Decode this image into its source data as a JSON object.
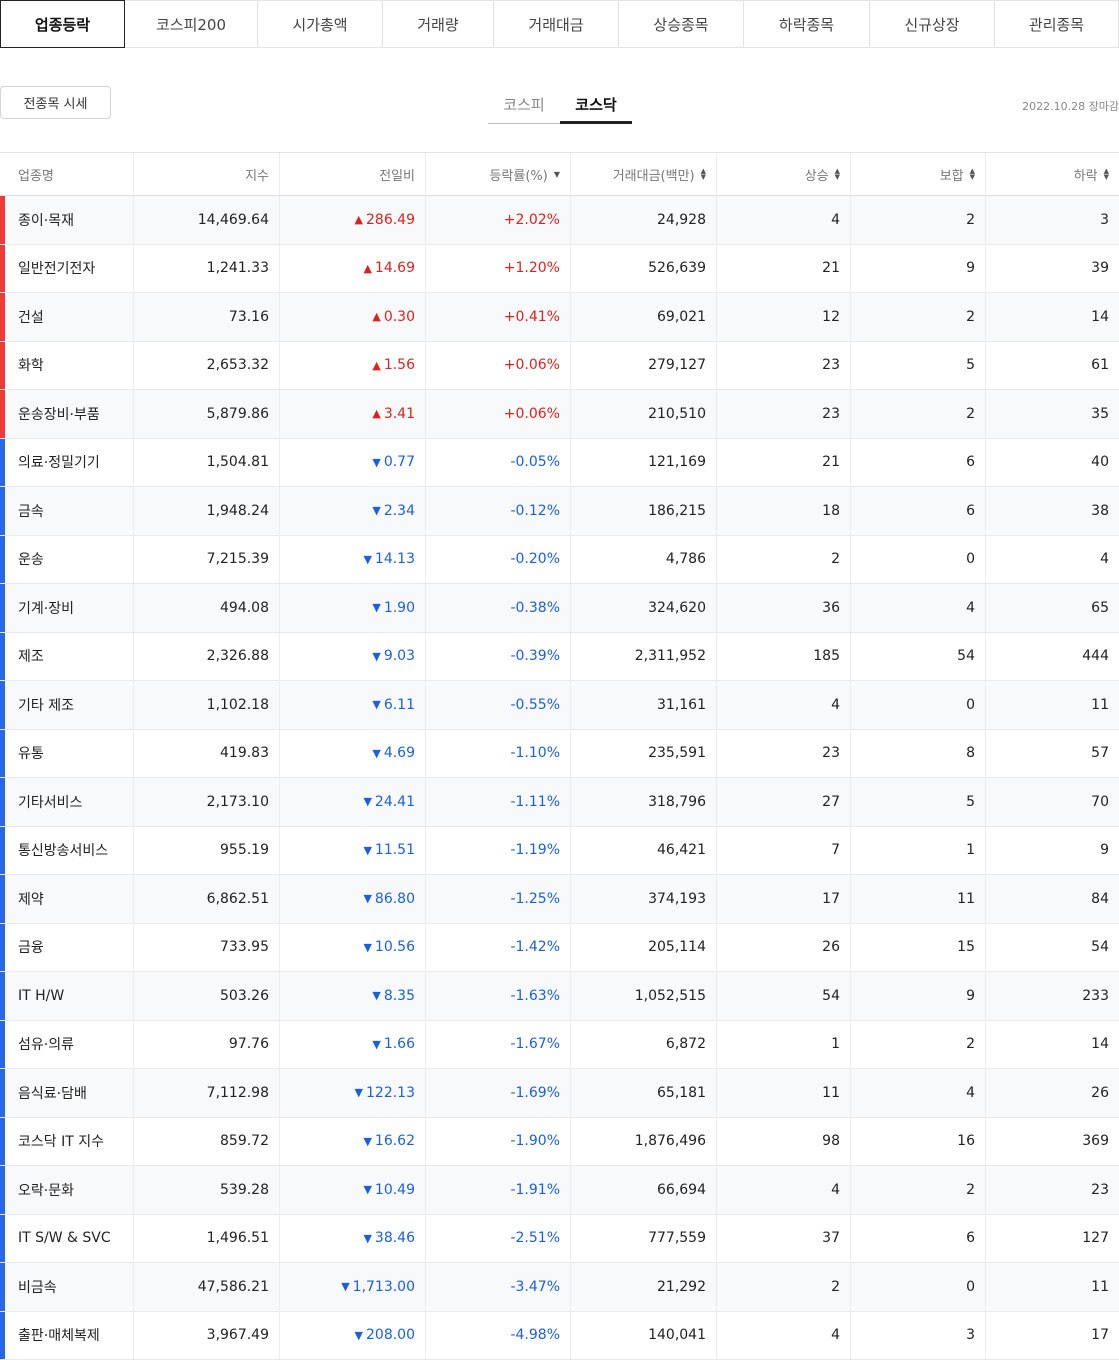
{
  "top_tabs": [
    "업종등락",
    "코스피200",
    "시가총액",
    "거래량",
    "거래대금",
    "상승종목",
    "하락종목",
    "신규상장",
    "관리종목"
  ],
  "all_stocks_button": "전종목 시세",
  "market_tabs": [
    "코스피",
    "코스닥"
  ],
  "active_market": "코스닥",
  "date_label": "2022.10.28 장마감",
  "columns": [
    "업종명",
    "지수",
    "전일비",
    "등락률(%)",
    "거래대금(백만)",
    "상승",
    "보합",
    "하락"
  ],
  "sort_icons": {
    "desc": "▼",
    "both": "▲▼"
  },
  "colors": {
    "up": "#e02020",
    "down": "#1a5fe0",
    "up_bar": "#ef3a3a",
    "down_bar": "#2a66e8"
  },
  "rows": [
    {
      "name": "종이·목재",
      "index": "14,469.64",
      "dir": "up",
      "change": "286.49",
      "rate": "+2.02%",
      "value": "24,928",
      "rise": "4",
      "flat": "2",
      "fall": "3"
    },
    {
      "name": "일반전기전자",
      "index": "1,241.33",
      "dir": "up",
      "change": "14.69",
      "rate": "+1.20%",
      "value": "526,639",
      "rise": "21",
      "flat": "9",
      "fall": "39"
    },
    {
      "name": "건설",
      "index": "73.16",
      "dir": "up",
      "change": "0.30",
      "rate": "+0.41%",
      "value": "69,021",
      "rise": "12",
      "flat": "2",
      "fall": "14"
    },
    {
      "name": "화학",
      "index": "2,653.32",
      "dir": "up",
      "change": "1.56",
      "rate": "+0.06%",
      "value": "279,127",
      "rise": "23",
      "flat": "5",
      "fall": "61"
    },
    {
      "name": "운송장비·부품",
      "index": "5,879.86",
      "dir": "up",
      "change": "3.41",
      "rate": "+0.06%",
      "value": "210,510",
      "rise": "23",
      "flat": "2",
      "fall": "35"
    },
    {
      "name": "의료·정밀기기",
      "index": "1,504.81",
      "dir": "down",
      "change": "0.77",
      "rate": "-0.05%",
      "value": "121,169",
      "rise": "21",
      "flat": "6",
      "fall": "40"
    },
    {
      "name": "금속",
      "index": "1,948.24",
      "dir": "down",
      "change": "2.34",
      "rate": "-0.12%",
      "value": "186,215",
      "rise": "18",
      "flat": "6",
      "fall": "38"
    },
    {
      "name": "운송",
      "index": "7,215.39",
      "dir": "down",
      "change": "14.13",
      "rate": "-0.20%",
      "value": "4,786",
      "rise": "2",
      "flat": "0",
      "fall": "4"
    },
    {
      "name": "기계·장비",
      "index": "494.08",
      "dir": "down",
      "change": "1.90",
      "rate": "-0.38%",
      "value": "324,620",
      "rise": "36",
      "flat": "4",
      "fall": "65"
    },
    {
      "name": "제조",
      "index": "2,326.88",
      "dir": "down",
      "change": "9.03",
      "rate": "-0.39%",
      "value": "2,311,952",
      "rise": "185",
      "flat": "54",
      "fall": "444"
    },
    {
      "name": "기타 제조",
      "index": "1,102.18",
      "dir": "down",
      "change": "6.11",
      "rate": "-0.55%",
      "value": "31,161",
      "rise": "4",
      "flat": "0",
      "fall": "11"
    },
    {
      "name": "유통",
      "index": "419.83",
      "dir": "down",
      "change": "4.69",
      "rate": "-1.10%",
      "value": "235,591",
      "rise": "23",
      "flat": "8",
      "fall": "57"
    },
    {
      "name": "기타서비스",
      "index": "2,173.10",
      "dir": "down",
      "change": "24.41",
      "rate": "-1.11%",
      "value": "318,796",
      "rise": "27",
      "flat": "5",
      "fall": "70"
    },
    {
      "name": "통신방송서비스",
      "index": "955.19",
      "dir": "down",
      "change": "11.51",
      "rate": "-1.19%",
      "value": "46,421",
      "rise": "7",
      "flat": "1",
      "fall": "9"
    },
    {
      "name": "제약",
      "index": "6,862.51",
      "dir": "down",
      "change": "86.80",
      "rate": "-1.25%",
      "value": "374,193",
      "rise": "17",
      "flat": "11",
      "fall": "84"
    },
    {
      "name": "금융",
      "index": "733.95",
      "dir": "down",
      "change": "10.56",
      "rate": "-1.42%",
      "value": "205,114",
      "rise": "26",
      "flat": "15",
      "fall": "54"
    },
    {
      "name": "IT H/W",
      "index": "503.26",
      "dir": "down",
      "change": "8.35",
      "rate": "-1.63%",
      "value": "1,052,515",
      "rise": "54",
      "flat": "9",
      "fall": "233"
    },
    {
      "name": "섬유·의류",
      "index": "97.76",
      "dir": "down",
      "change": "1.66",
      "rate": "-1.67%",
      "value": "6,872",
      "rise": "1",
      "flat": "2",
      "fall": "14"
    },
    {
      "name": "음식료·담배",
      "index": "7,112.98",
      "dir": "down",
      "change": "122.13",
      "rate": "-1.69%",
      "value": "65,181",
      "rise": "11",
      "flat": "4",
      "fall": "26"
    },
    {
      "name": "코스닥 IT 지수",
      "index": "859.72",
      "dir": "down",
      "change": "16.62",
      "rate": "-1.90%",
      "value": "1,876,496",
      "rise": "98",
      "flat": "16",
      "fall": "369"
    },
    {
      "name": "오락·문화",
      "index": "539.28",
      "dir": "down",
      "change": "10.49",
      "rate": "-1.91%",
      "value": "66,694",
      "rise": "4",
      "flat": "2",
      "fall": "23"
    },
    {
      "name": "IT S/W & SVC",
      "index": "1,496.51",
      "dir": "down",
      "change": "38.46",
      "rate": "-2.51%",
      "value": "777,559",
      "rise": "37",
      "flat": "6",
      "fall": "127"
    },
    {
      "name": "비금속",
      "index": "47,586.21",
      "dir": "down",
      "change": "1,713.00",
      "rate": "-3.47%",
      "value": "21,292",
      "rise": "2",
      "flat": "0",
      "fall": "11"
    },
    {
      "name": "출판·매체복제",
      "index": "3,967.49",
      "dir": "down",
      "change": "208.00",
      "rate": "-4.98%",
      "value": "140,041",
      "rise": "4",
      "flat": "3",
      "fall": "17"
    }
  ]
}
